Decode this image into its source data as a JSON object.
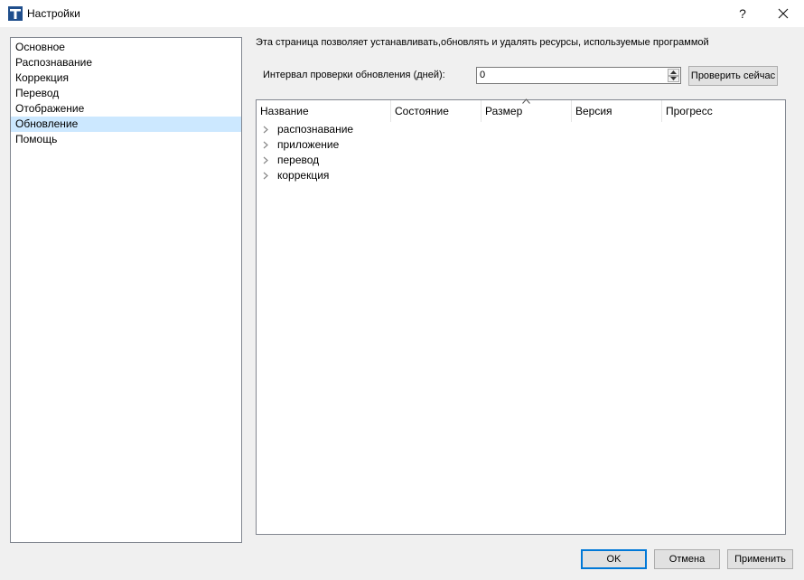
{
  "window": {
    "title": "Настройки",
    "help_glyph": "?",
    "close_glyph": "✕",
    "icon": "app-icon"
  },
  "nav": {
    "items": [
      {
        "label": "Основное",
        "selected": false
      },
      {
        "label": "Распознавание",
        "selected": false
      },
      {
        "label": "Коррекция",
        "selected": false
      },
      {
        "label": "Перевод",
        "selected": false
      },
      {
        "label": "Отображение",
        "selected": false
      },
      {
        "label": "Обновление",
        "selected": true
      },
      {
        "label": "Помощь",
        "selected": false
      }
    ]
  },
  "update_page": {
    "description": "Эта страница позволяет устанавливать,обновлять и удалять ресурсы, используемые программой",
    "interval_label": "Интервал проверки обновления (дней):",
    "interval_value": "0",
    "check_now_label": "Проверить сейчас"
  },
  "tree": {
    "columns": [
      "Название",
      "Состояние",
      "Размер",
      "Версия",
      "Прогресс"
    ],
    "sorted_column": "Размер",
    "rows": [
      {
        "label": "распознавание"
      },
      {
        "label": "приложение"
      },
      {
        "label": "перевод"
      },
      {
        "label": "коррекция"
      }
    ]
  },
  "footer": {
    "ok_label": "OK",
    "cancel_label": "Отмена",
    "apply_label": "Применить"
  },
  "colors": {
    "selection": "#cce8ff",
    "default_button_border": "#0078d7",
    "icon_blue": "#1f4e8c"
  }
}
